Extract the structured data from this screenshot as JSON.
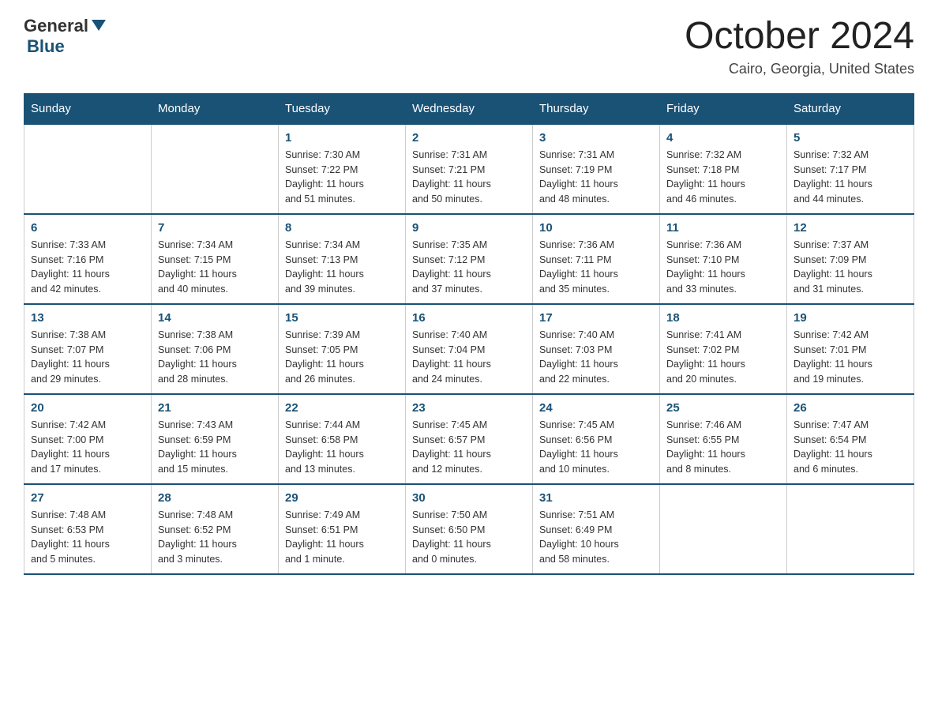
{
  "header": {
    "logo_general": "General",
    "logo_blue": "Blue",
    "month_title": "October 2024",
    "location": "Cairo, Georgia, United States"
  },
  "days_of_week": [
    "Sunday",
    "Monday",
    "Tuesday",
    "Wednesday",
    "Thursday",
    "Friday",
    "Saturday"
  ],
  "weeks": [
    [
      {
        "day": "",
        "info": ""
      },
      {
        "day": "",
        "info": ""
      },
      {
        "day": "1",
        "info": "Sunrise: 7:30 AM\nSunset: 7:22 PM\nDaylight: 11 hours\nand 51 minutes."
      },
      {
        "day": "2",
        "info": "Sunrise: 7:31 AM\nSunset: 7:21 PM\nDaylight: 11 hours\nand 50 minutes."
      },
      {
        "day": "3",
        "info": "Sunrise: 7:31 AM\nSunset: 7:19 PM\nDaylight: 11 hours\nand 48 minutes."
      },
      {
        "day": "4",
        "info": "Sunrise: 7:32 AM\nSunset: 7:18 PM\nDaylight: 11 hours\nand 46 minutes."
      },
      {
        "day": "5",
        "info": "Sunrise: 7:32 AM\nSunset: 7:17 PM\nDaylight: 11 hours\nand 44 minutes."
      }
    ],
    [
      {
        "day": "6",
        "info": "Sunrise: 7:33 AM\nSunset: 7:16 PM\nDaylight: 11 hours\nand 42 minutes."
      },
      {
        "day": "7",
        "info": "Sunrise: 7:34 AM\nSunset: 7:15 PM\nDaylight: 11 hours\nand 40 minutes."
      },
      {
        "day": "8",
        "info": "Sunrise: 7:34 AM\nSunset: 7:13 PM\nDaylight: 11 hours\nand 39 minutes."
      },
      {
        "day": "9",
        "info": "Sunrise: 7:35 AM\nSunset: 7:12 PM\nDaylight: 11 hours\nand 37 minutes."
      },
      {
        "day": "10",
        "info": "Sunrise: 7:36 AM\nSunset: 7:11 PM\nDaylight: 11 hours\nand 35 minutes."
      },
      {
        "day": "11",
        "info": "Sunrise: 7:36 AM\nSunset: 7:10 PM\nDaylight: 11 hours\nand 33 minutes."
      },
      {
        "day": "12",
        "info": "Sunrise: 7:37 AM\nSunset: 7:09 PM\nDaylight: 11 hours\nand 31 minutes."
      }
    ],
    [
      {
        "day": "13",
        "info": "Sunrise: 7:38 AM\nSunset: 7:07 PM\nDaylight: 11 hours\nand 29 minutes."
      },
      {
        "day": "14",
        "info": "Sunrise: 7:38 AM\nSunset: 7:06 PM\nDaylight: 11 hours\nand 28 minutes."
      },
      {
        "day": "15",
        "info": "Sunrise: 7:39 AM\nSunset: 7:05 PM\nDaylight: 11 hours\nand 26 minutes."
      },
      {
        "day": "16",
        "info": "Sunrise: 7:40 AM\nSunset: 7:04 PM\nDaylight: 11 hours\nand 24 minutes."
      },
      {
        "day": "17",
        "info": "Sunrise: 7:40 AM\nSunset: 7:03 PM\nDaylight: 11 hours\nand 22 minutes."
      },
      {
        "day": "18",
        "info": "Sunrise: 7:41 AM\nSunset: 7:02 PM\nDaylight: 11 hours\nand 20 minutes."
      },
      {
        "day": "19",
        "info": "Sunrise: 7:42 AM\nSunset: 7:01 PM\nDaylight: 11 hours\nand 19 minutes."
      }
    ],
    [
      {
        "day": "20",
        "info": "Sunrise: 7:42 AM\nSunset: 7:00 PM\nDaylight: 11 hours\nand 17 minutes."
      },
      {
        "day": "21",
        "info": "Sunrise: 7:43 AM\nSunset: 6:59 PM\nDaylight: 11 hours\nand 15 minutes."
      },
      {
        "day": "22",
        "info": "Sunrise: 7:44 AM\nSunset: 6:58 PM\nDaylight: 11 hours\nand 13 minutes."
      },
      {
        "day": "23",
        "info": "Sunrise: 7:45 AM\nSunset: 6:57 PM\nDaylight: 11 hours\nand 12 minutes."
      },
      {
        "day": "24",
        "info": "Sunrise: 7:45 AM\nSunset: 6:56 PM\nDaylight: 11 hours\nand 10 minutes."
      },
      {
        "day": "25",
        "info": "Sunrise: 7:46 AM\nSunset: 6:55 PM\nDaylight: 11 hours\nand 8 minutes."
      },
      {
        "day": "26",
        "info": "Sunrise: 7:47 AM\nSunset: 6:54 PM\nDaylight: 11 hours\nand 6 minutes."
      }
    ],
    [
      {
        "day": "27",
        "info": "Sunrise: 7:48 AM\nSunset: 6:53 PM\nDaylight: 11 hours\nand 5 minutes."
      },
      {
        "day": "28",
        "info": "Sunrise: 7:48 AM\nSunset: 6:52 PM\nDaylight: 11 hours\nand 3 minutes."
      },
      {
        "day": "29",
        "info": "Sunrise: 7:49 AM\nSunset: 6:51 PM\nDaylight: 11 hours\nand 1 minute."
      },
      {
        "day": "30",
        "info": "Sunrise: 7:50 AM\nSunset: 6:50 PM\nDaylight: 11 hours\nand 0 minutes."
      },
      {
        "day": "31",
        "info": "Sunrise: 7:51 AM\nSunset: 6:49 PM\nDaylight: 10 hours\nand 58 minutes."
      },
      {
        "day": "",
        "info": ""
      },
      {
        "day": "",
        "info": ""
      }
    ]
  ]
}
